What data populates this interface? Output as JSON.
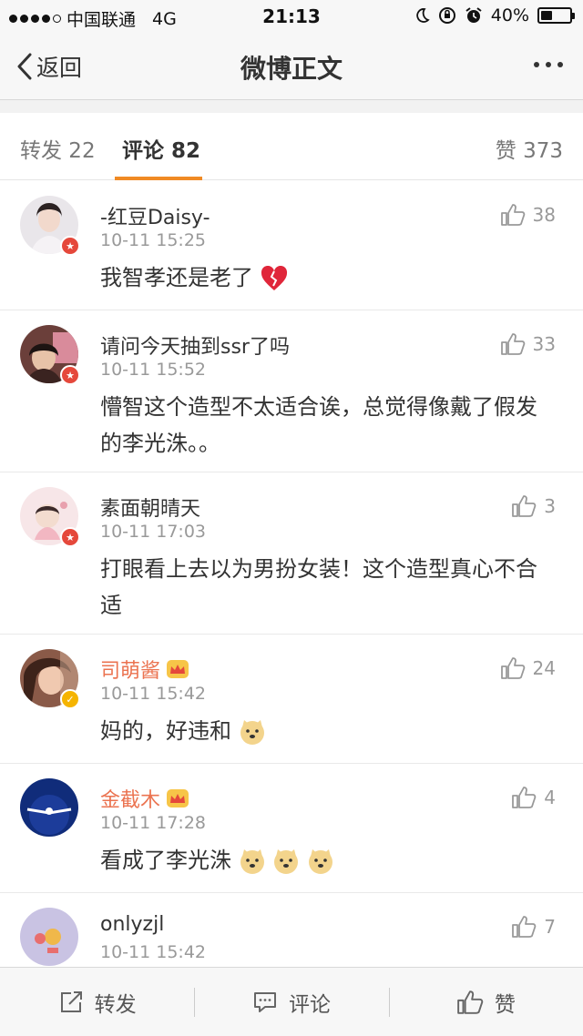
{
  "status_bar": {
    "carrier": "中国联通",
    "network": "4G",
    "time": "21:13",
    "battery": "40%",
    "battery_level": 0.4
  },
  "nav": {
    "back_label": "返回",
    "title": "微博正文"
  },
  "tabs": {
    "repost": "转发 22",
    "comment": "评论 82",
    "like": "赞 373"
  },
  "comments": [
    {
      "user": "-红豆Daisy-",
      "time": "10-11 15:25",
      "text": "我智孝还是老了",
      "likes": "38",
      "vip": false,
      "badge": "red"
    },
    {
      "user": "请问今天抽到ssr了吗",
      "time": "10-11 15:52",
      "text": "懵智这个造型不太适合诶，总觉得像戴了假发的李光洙。。",
      "likes": "33",
      "vip": false,
      "badge": "red"
    },
    {
      "user": "素面朝晴天",
      "time": "10-11 17:03",
      "text": "打眼看上去以为男扮女装！这个造型真心不合适",
      "likes": "3",
      "vip": false,
      "badge": "red"
    },
    {
      "user": "司萌酱",
      "time": "10-11 15:42",
      "text": "妈的，好违和",
      "likes": "24",
      "vip": true,
      "badge": "yellow"
    },
    {
      "user": "金截木",
      "time": "10-11 17:28",
      "text": "看成了李光洙",
      "likes": "4",
      "vip": true,
      "badge": "none"
    },
    {
      "user": "onlyzjl",
      "time": "10-11 15:42",
      "text": "",
      "likes": "7",
      "vip": false,
      "badge": "none"
    }
  ],
  "toolbar": {
    "repost": "转发",
    "comment": "评论",
    "like": "赞"
  },
  "colors": {
    "accent": "#f08a24",
    "vip_name": "#eb7350",
    "badge_red": "#e5483b",
    "badge_yellow": "#f5b400"
  }
}
